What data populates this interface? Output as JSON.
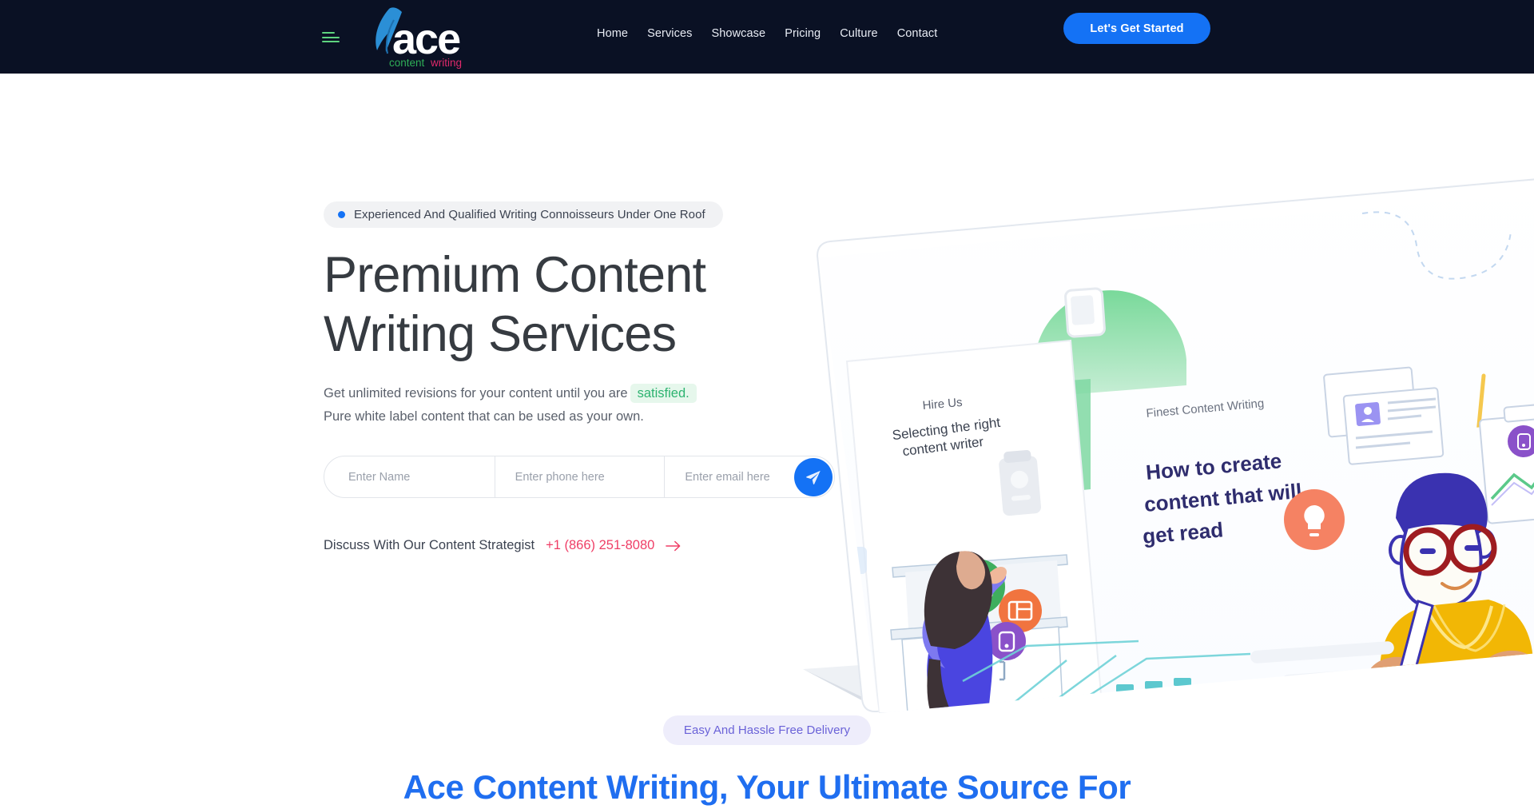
{
  "header": {
    "menu_icon": "hamburger-icon",
    "logo": {
      "main_text": "ace",
      "sub_left": "content",
      "sub_right": "writing",
      "quill_color": "#2b8fd6",
      "main_color": "#ffffff",
      "sub_left_color": "#2fae57",
      "sub_right_color": "#e0296b"
    },
    "nav": [
      {
        "label": "Home"
      },
      {
        "label": "Services"
      },
      {
        "label": "Showcase"
      },
      {
        "label": "Pricing"
      },
      {
        "label": "Culture"
      },
      {
        "label": "Contact"
      }
    ],
    "cta_label": "Let's Get Started",
    "cta_color": "#1472f5",
    "background": "#0a1124"
  },
  "hero": {
    "eyebrow": "Experienced And Qualified Writing Connoisseurs Under One Roof",
    "eyebrow_dot_color": "#1472f5",
    "title": "Premium Content Writing Services",
    "sub_line1_before": "Get unlimited revisions for your content until you are",
    "sub_highlight": "satisfied.",
    "sub_highlight_color": "#2db370",
    "sub_line2": "Pure white label content that can be used as your own.",
    "form": {
      "name_placeholder": "Enter Name",
      "phone_placeholder": "Enter phone here",
      "email_placeholder": "Enter email here",
      "name_value": "",
      "phone_value": "",
      "email_value": "",
      "submit_icon": "send-paper-plane-icon"
    },
    "strategist": {
      "label": "Discuss With Our Content Strategist",
      "phone": "+1 (866) 251-8080",
      "phone_color": "#ef3e66",
      "arrow_icon": "arrow-right-icon"
    }
  },
  "illustration": {
    "device": "laptop-mockup",
    "panel_left": {
      "kicker": "Hire Us",
      "headline_line1": "Selecting the right",
      "headline_line2": "content writer",
      "person": "woman-pointing-at-board",
      "bubbles": [
        {
          "name": "book-icon-bubble",
          "color": "#3fae5e"
        },
        {
          "name": "layout-icon-bubble",
          "color": "#f1743f"
        },
        {
          "name": "document-icon-bubble",
          "color": "#8a51c9"
        }
      ]
    },
    "panel_right": {
      "kicker": "Finest Content Writing",
      "headline_line1": "How to create",
      "headline_line2": "content that will",
      "headline_line3": "get read",
      "person": "man-with-glasses-writing",
      "accents": [
        {
          "name": "lightbulb-icon-bubble",
          "color": "#f58263"
        },
        {
          "name": "document-icon-bubble",
          "color": "#8a51c9"
        }
      ]
    }
  },
  "lower_section": {
    "badge": "Easy And Hassle Free Delivery",
    "badge_color": "#6a62d8",
    "heading": "Ace Content Writing, Your Ultimate Source For",
    "heading_color": "#1f6ef0"
  }
}
